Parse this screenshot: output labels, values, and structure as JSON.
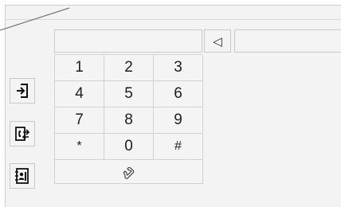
{
  "keypad": {
    "keys": [
      "1",
      "2",
      "3",
      "4",
      "5",
      "6",
      "7",
      "8",
      "9",
      "*",
      "0",
      "#"
    ]
  },
  "toolbar": {
    "backspace_glyph": "◁"
  },
  "icons": {
    "call": "phone-handset-icon",
    "sidebar": [
      "login-door-icon",
      "call-transfer-icon",
      "contacts-book-icon"
    ]
  },
  "colors": {
    "panel": "#f3f3f3",
    "border": "#c9c9c9",
    "text": "#1e1e1e"
  }
}
